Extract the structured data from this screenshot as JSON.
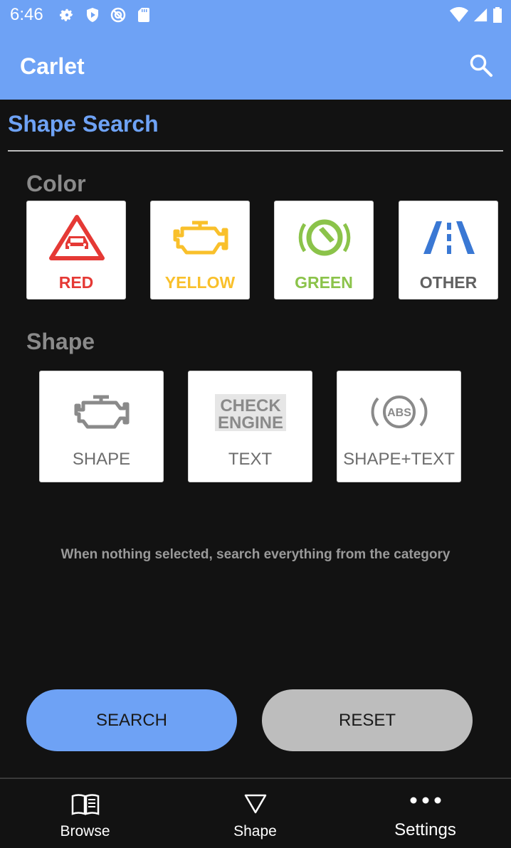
{
  "status_bar": {
    "time": "6:46",
    "left_icons": [
      "settings-icon",
      "shield-play-icon",
      "vpn-icon",
      "sd-card-icon"
    ],
    "right_icons": [
      "wifi-icon",
      "signal-icon",
      "battery-icon"
    ]
  },
  "app_bar": {
    "title": "Carlet",
    "action_icon": "search-icon"
  },
  "page": {
    "title": "Shape Search"
  },
  "color_section": {
    "label": "Color",
    "options": [
      {
        "label": "RED",
        "color": "#e53935",
        "icon": "car-warning-triangle-icon"
      },
      {
        "label": "YELLOW",
        "color": "#f9c02b",
        "icon": "engine-icon"
      },
      {
        "label": "GREEN",
        "color": "#8bc34a",
        "icon": "steering-wheel-icon"
      },
      {
        "label": "OTHER",
        "color": "#616161",
        "icon": "lane-icon"
      }
    ]
  },
  "shape_section": {
    "label": "Shape",
    "options": [
      {
        "label": "SHAPE",
        "icon": "engine-icon"
      },
      {
        "label": "TEXT",
        "icon": "check-engine-text-icon",
        "icon_text_line1": "CHECK",
        "icon_text_line2": "ENGINE"
      },
      {
        "label": "SHAPE+TEXT",
        "icon": "abs-icon",
        "icon_text": "ABS"
      }
    ]
  },
  "hint": "When nothing selected, search everything from the category",
  "buttons": {
    "search": "SEARCH",
    "reset": "RESET"
  },
  "bottom_nav": [
    {
      "label": "Browse",
      "icon": "book-icon"
    },
    {
      "label": "Shape",
      "icon": "triangle-icon"
    },
    {
      "label": "Settings",
      "icon": "more-dots-icon"
    }
  ],
  "colors": {
    "accent": "#6ea2f5",
    "background": "#121212",
    "reset_button": "#bdbdbd"
  }
}
